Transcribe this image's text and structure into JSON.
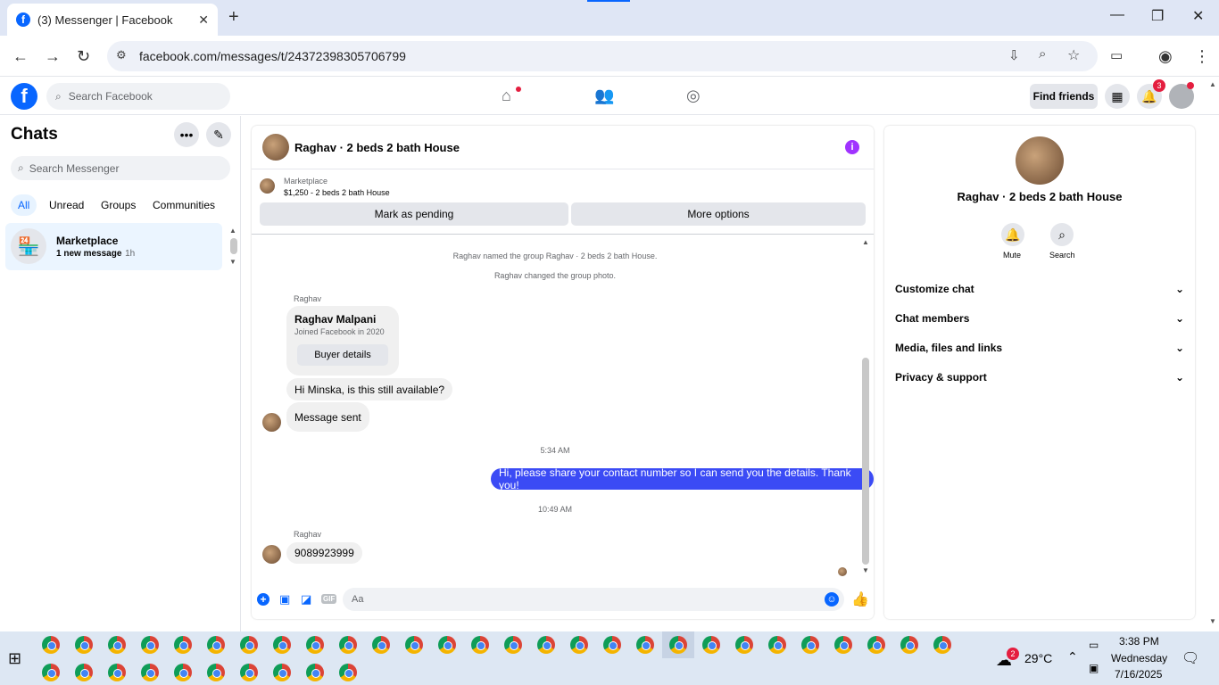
{
  "browser": {
    "tab_title": "(3) Messenger | Facebook",
    "url": "facebook.com/messages/t/24372398305706799",
    "new_tab": "+",
    "close_tab": "✕",
    "minimize": "—",
    "maximize": "❐",
    "close": "✕"
  },
  "fb_header": {
    "search_placeholder": "Search Facebook",
    "find_friends": "Find friends",
    "notification_count": "3"
  },
  "left": {
    "title": "Chats",
    "search_placeholder": "Search Messenger",
    "filters": [
      "All",
      "Unread",
      "Groups",
      "Communities"
    ],
    "chat": {
      "name": "Marketplace",
      "preview": "1 new message",
      "time": "· 1h"
    }
  },
  "conversation": {
    "title": "Raghav · 2 beds 2 bath House",
    "listing_source": "Marketplace",
    "listing_summary": "$1,250 - 2 beds 2 bath House",
    "mark_pending": "Mark as pending",
    "more_options": "More options",
    "system_1": "Raghav named the group Raghav · 2 beds 2 bath House.",
    "system_2": "Raghav changed the group photo.",
    "sender_label_1": "Raghav",
    "card_name": "Raghav Malpani",
    "card_sub": "Joined Facebook in 2020",
    "card_button": "Buyer details",
    "msg_1": "Hi Minska, is this still available?",
    "msg_2": "Message sent",
    "time_1": "5:34 AM",
    "msg_outgoing": "Hi, please share your contact number so I can send you the details. Thank you!",
    "time_2": "10:49 AM",
    "sender_label_2": "Raghav",
    "msg_3": "9089923999",
    "composer_placeholder": "Aa"
  },
  "right": {
    "title": "Raghav · 2 beds 2 bath House",
    "mute": "Mute",
    "search": "Search",
    "sections": [
      "Customize chat",
      "Chat members",
      "Media, files and links",
      "Privacy & support"
    ]
  },
  "taskbar": {
    "weather_badge": "2",
    "temperature": "29°C",
    "time": "3:38 PM",
    "day": "Wednesday",
    "date": "7/16/2025"
  },
  "colors": {
    "accent": "#0866ff",
    "outgoing_bubble": "#3b4bf5",
    "info_icon": "#a033ff"
  }
}
